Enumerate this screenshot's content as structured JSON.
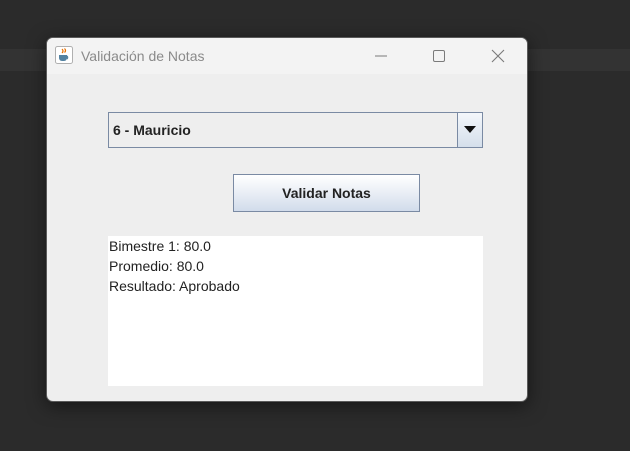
{
  "window": {
    "title": "Validación de Notas",
    "app_icon": "java-cup-icon"
  },
  "title_controls": {
    "minimize_icon": "minimize-icon",
    "maximize_icon": "maximize-icon",
    "close_icon": "close-icon"
  },
  "student_select": {
    "selected": "6 - Mauricio",
    "arrow_icon": "chevron-down-icon"
  },
  "actions": {
    "validate_label": "Validar Notas"
  },
  "output": {
    "lines": [
      "Bimestre 1: 80.0",
      "Promedio: 80.0",
      "Resultado: Aprobado"
    ]
  },
  "colors": {
    "desktop_bg": "#2b2b2b",
    "window_bg": "#eeeeee",
    "border_blue": "#7a8aa3"
  }
}
